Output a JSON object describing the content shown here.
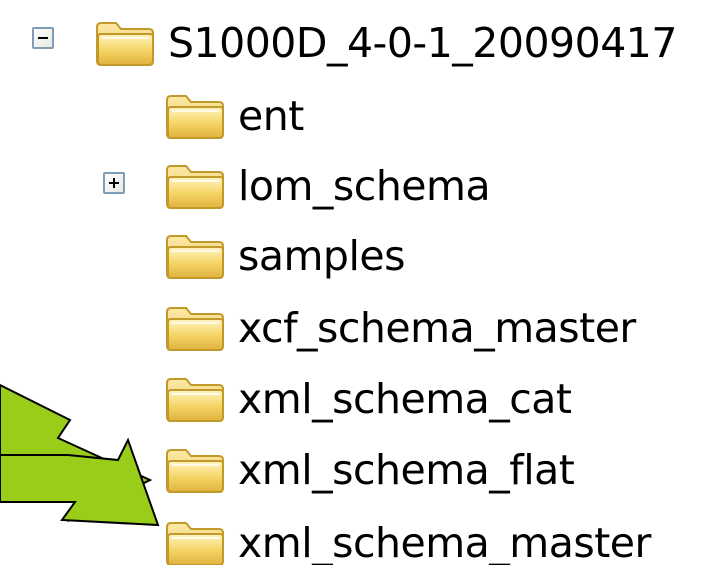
{
  "tree": {
    "root": {
      "label": "S1000D_4-0-1_20090417",
      "expander": "minus-icon",
      "icon": "folder-icon"
    },
    "children": [
      {
        "label": "ent",
        "icon": "folder-icon"
      },
      {
        "label": "lom_schema",
        "icon": "folder-icon",
        "expander": "plus-icon"
      },
      {
        "label": "samples",
        "icon": "folder-icon"
      },
      {
        "label": "xcf_schema_master",
        "icon": "folder-icon"
      },
      {
        "label": "xml_schema_cat",
        "icon": "folder-icon"
      },
      {
        "label": "xml_schema_flat",
        "icon": "folder-icon"
      },
      {
        "label": "xml_schema_master",
        "icon": "folder-icon"
      }
    ]
  },
  "colors": {
    "arrow_fill": "#9acd1a",
    "arrow_stroke": "#000000",
    "folder_body": "#f6d66a",
    "folder_edge": "#c29a2c",
    "expander_border": "#7f9db9"
  }
}
